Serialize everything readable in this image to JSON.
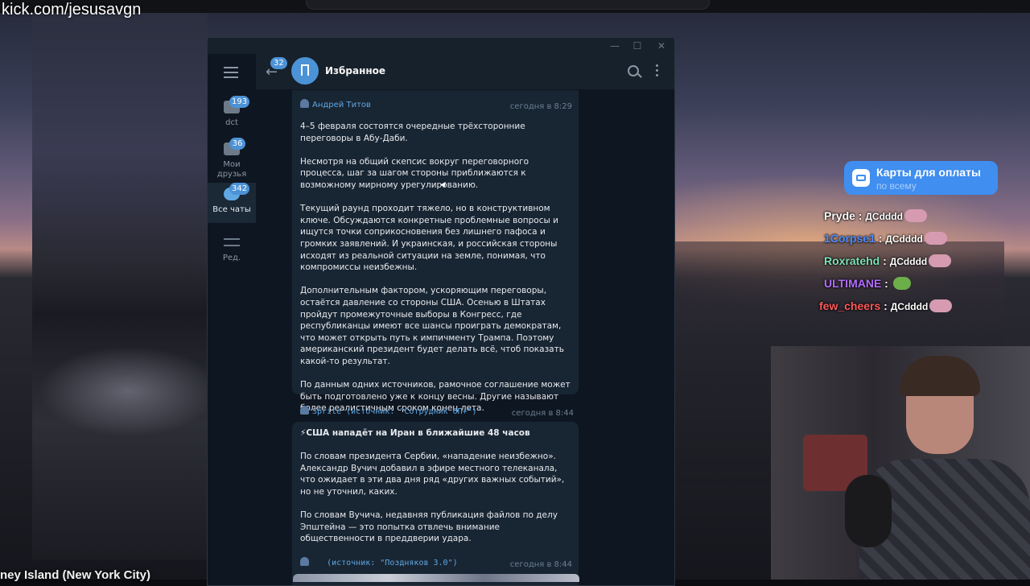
{
  "stream": {
    "url": "kick.com/jesusavgn",
    "location": "ney Island (New York City)"
  },
  "telegram": {
    "sidebar": {
      "folders": [
        {
          "label": "dct",
          "badge": "193"
        },
        {
          "label": "Мои\nдрузья",
          "badge": "36"
        },
        {
          "label": "Все чаты",
          "badge": "342",
          "active": true
        },
        {
          "label": "Ред.",
          "badge": ""
        }
      ]
    },
    "header": {
      "back_badge": "32",
      "title": "Избранное"
    },
    "messages": [
      {
        "forwarded_from": "Андрей Титов",
        "time": "сегодня в 8:29",
        "paragraphs": [
          "4–5 февраля состоятся очередные трёхсторонние переговоры в Абу-Даби.",
          "Несмотря на общий скепсис вокруг переговорного процесса, шаг за шагом стороны приближаются к возможному мирному урегулированию.",
          "Текущий раунд проходит тяжело, но в конструктивном ключе. Обсуждаются конкретные проблемные вопросы и ищутся точки соприкосновения без лишнего пафоса и громких заявлений. И украинская, и российская стороны исходят из реальной ситуации на земле, понимая, что компромиссы неизбежны.",
          "Дополнительным фактором, ускоряющим переговоры, остаётся давление со стороны США. Осенью в Штатах пройдут промежуточные выборы в Конгресс, где республиканцы имеют все шансы проиграть демократам, что может открыть путь к импичменту Трампа. Поэтому американский президент будет делать всё, чтоб показать какой-то результат.",
          "По данным одних источников, рамочное соглашение может быть подготовлено уже к концу весны. Другие называют более реалистичным сроком конец лета."
        ]
      },
      {
        "forwarded_from": "Sprite (источник: \"Сотрудник ОП+\")",
        "time": "сегодня в 8:44",
        "headline": "⚡США нападёт на Иран в ближайшие 48 часов",
        "paragraphs": [
          "По словам президента Сербии, «нападение неизбежно». Александр Вучич добавил в эфире местного телеканала, что ожидает в эти два дня ряд «других важных событий», но не уточнил, каких.",
          "По словам Вучича, недавняя публикация файлов по делу Эпштейна — это попытка отвлечь внимание общественности в преддверии удара."
        ]
      },
      {
        "forwarded_from": "(источник: \"Поздняков 3.0\")",
        "time": "сегодня в 8:44"
      }
    ]
  },
  "paycard": {
    "title": "Карты для оплаты",
    "subtitle": "по всему"
  },
  "stream_chat": [
    {
      "user": "Pryde",
      "color": "#ffffff",
      "text": "ДСdddd"
    },
    {
      "user": "1Corpse1",
      "color": "#4f8cff",
      "text": "ДСdddd"
    },
    {
      "user": "Roxratehd",
      "color": "#7de0b6",
      "text": "ДСdddd"
    },
    {
      "user": "ULTIMANE",
      "color": "#b36dff",
      "text": ""
    },
    {
      "user": "few_cheers",
      "color": "#ff5a5a",
      "text": "ДСdddd"
    }
  ],
  "colors": {
    "telegram_accent": "#4c92d6",
    "paycard": "#3f8ef0"
  }
}
